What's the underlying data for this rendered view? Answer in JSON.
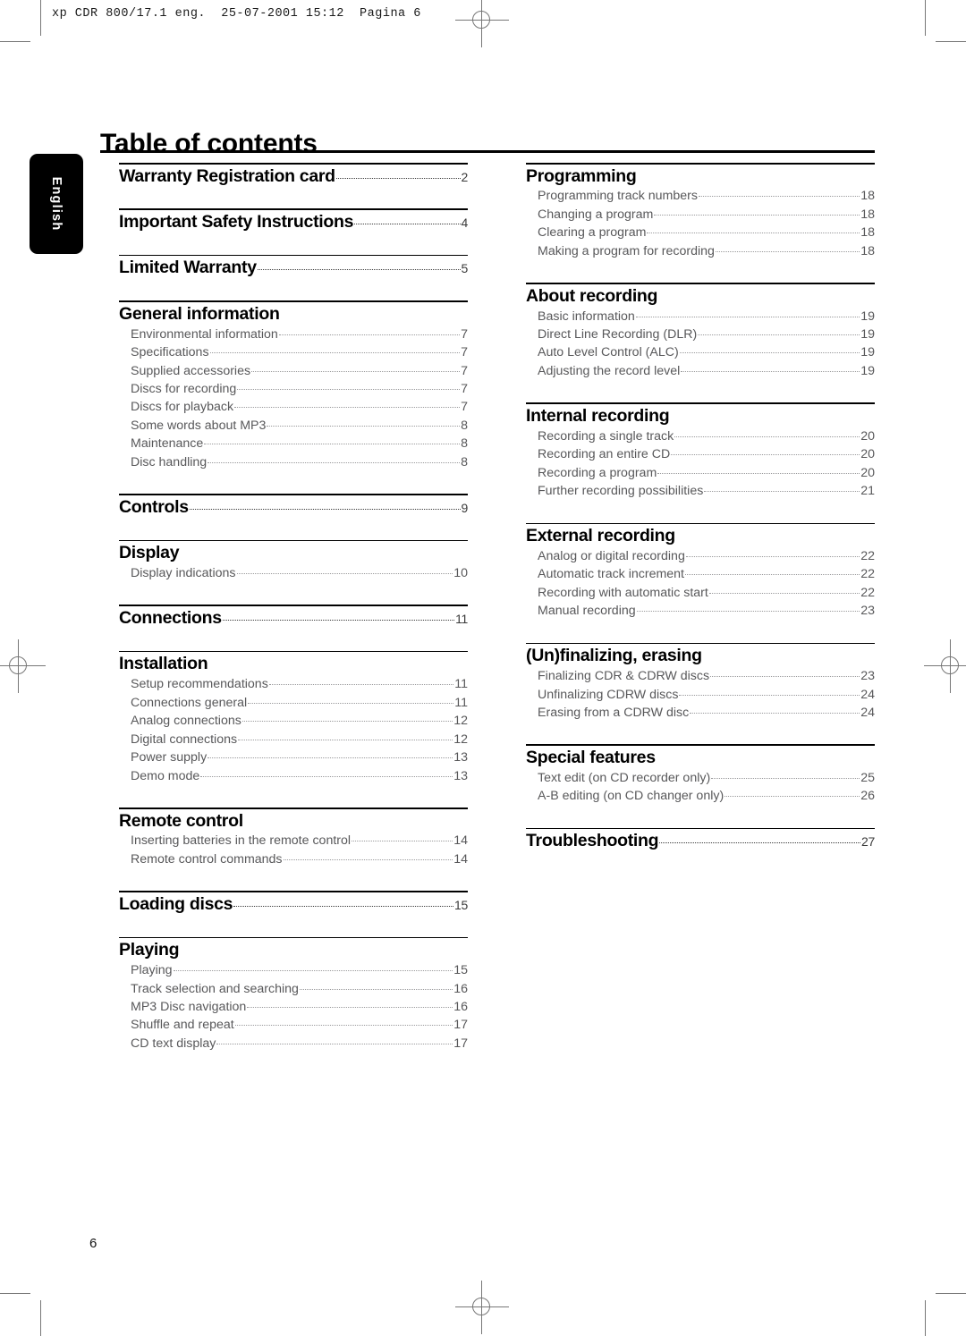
{
  "print_slug": "xp CDR 800/17.1 eng.  25-07-2001 15:12  Pagina 6",
  "language_tab": "English",
  "page_title": "Table of contents",
  "folio": "6",
  "colors": {
    "text": "#000000",
    "entry_text": "#58585a",
    "rule": "#000000",
    "tab_background": "#000000",
    "tab_text": "#ffffff",
    "crop_mark": "#777777"
  },
  "columns": [
    {
      "name": "left-column",
      "sections": [
        {
          "heading": "Warranty Registration card",
          "page": "2",
          "entries": []
        },
        {
          "heading": "Important Safety Instructions",
          "page": "4",
          "entries": []
        },
        {
          "heading": "Limited Warranty",
          "page": "5",
          "entries": []
        },
        {
          "heading": "General information",
          "page": "",
          "entries": [
            {
              "label": "Environmental information",
              "page": "7"
            },
            {
              "label": "Specifications",
              "page": "7"
            },
            {
              "label": "Supplied accessories",
              "page": "7"
            },
            {
              "label": "Discs for recording",
              "page": "7"
            },
            {
              "label": "Discs for playback",
              "page": "7"
            },
            {
              "label": "Some words about MP3",
              "page": "8"
            },
            {
              "label": "Maintenance",
              "page": "8"
            },
            {
              "label": "Disc handling ",
              "page": "8"
            }
          ]
        },
        {
          "heading": "Controls",
          "page": "9",
          "entries": []
        },
        {
          "heading": "Display",
          "page": "",
          "entries": [
            {
              "label": "Display indications",
              "page": "10"
            }
          ]
        },
        {
          "heading": "Connections",
          "page": "11",
          "entries": []
        },
        {
          "heading": "Installation",
          "page": "",
          "entries": [
            {
              "label": "Setup recommendations",
              "page": "11"
            },
            {
              "label": "Connections general ",
              "page": "11"
            },
            {
              "label": "Analog connections ",
              "page": "12"
            },
            {
              "label": "Digital connections",
              "page": "12"
            },
            {
              "label": "Power supply",
              "page": "13"
            },
            {
              "label": "Demo mode",
              "page": "13"
            }
          ]
        },
        {
          "heading": "Remote control",
          "page": "",
          "entries": [
            {
              "label": "Inserting batteries in the remote control",
              "page": "14"
            },
            {
              "label": "Remote control commands",
              "page": "14"
            }
          ]
        },
        {
          "heading": "Loading discs",
          "page": "15",
          "entries": []
        },
        {
          "heading": "Playing",
          "page": "",
          "entries": [
            {
              "label": "Playing",
              "page": "15"
            },
            {
              "label": "Track selection and searching",
              "page": "16"
            },
            {
              "label": "MP3 Disc navigation ",
              "page": "16"
            },
            {
              "label": "Shuffle and repeat",
              "page": "17"
            },
            {
              "label": "CD text display",
              "page": "17"
            }
          ]
        }
      ]
    },
    {
      "name": "right-column",
      "sections": [
        {
          "heading": "Programming",
          "page": "",
          "entries": [
            {
              "label": "Programming track numbers",
              "page": "18"
            },
            {
              "label": "Changing a program ",
              "page": "18"
            },
            {
              "label": "Clearing a program ",
              "page": "18"
            },
            {
              "label": "Making a program for recording",
              "page": "18"
            }
          ]
        },
        {
          "heading": "About recording",
          "page": "",
          "entries": [
            {
              "label": "Basic information",
              "page": "19"
            },
            {
              "label": "Direct Line Recording (DLR) ",
              "page": "19"
            },
            {
              "label": "Auto Level Control (ALC) ",
              "page": "19"
            },
            {
              "label": "Adjusting the record level ",
              "page": "19"
            }
          ]
        },
        {
          "heading": "Internal recording",
          "page": "",
          "entries": [
            {
              "label": "Recording a single track",
              "page": "20"
            },
            {
              "label": "Recording an entire CD ",
              "page": "20"
            },
            {
              "label": "Recording a program",
              "page": "20"
            },
            {
              "label": "Further recording possibilities",
              "page": "21"
            }
          ]
        },
        {
          "heading": "External recording",
          "page": "",
          "entries": [
            {
              "label": "Analog or digital recording ",
              "page": "22"
            },
            {
              "label": "Automatic track increment",
              "page": "22"
            },
            {
              "label": "Recording with automatic start",
              "page": "22"
            },
            {
              "label": "Manual recording",
              "page": "23"
            }
          ]
        },
        {
          "heading": "(Un)finalizing, erasing",
          "page": "",
          "entries": [
            {
              "label": "Finalizing CDR & CDRW discs",
              "page": "23"
            },
            {
              "label": "Unfinalizing CDRW discs",
              "page": "24"
            },
            {
              "label": "Erasing from a CDRW disc ",
              "page": "24"
            }
          ]
        },
        {
          "heading": "Special features",
          "page": "",
          "entries": [
            {
              "label": "Text edit (on CD recorder only) ",
              "page": "25"
            },
            {
              "label": "A-B editing (on CD changer only) ",
              "page": "26"
            }
          ]
        },
        {
          "heading": "Troubleshooting",
          "page": "27",
          "entries": []
        }
      ]
    }
  ]
}
